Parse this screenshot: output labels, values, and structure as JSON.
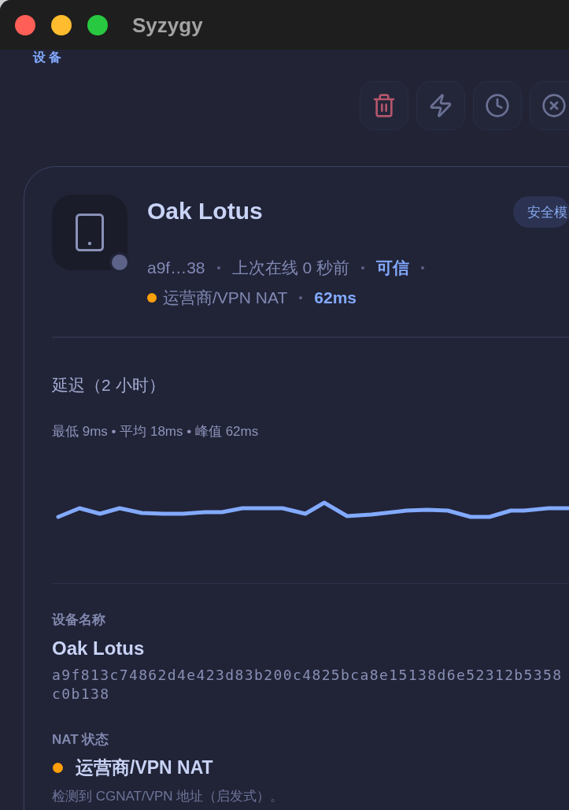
{
  "window": {
    "title": "Syzygy"
  },
  "breadcrumb": {
    "label": "设备"
  },
  "device": {
    "name": "Oak Lotus",
    "online": false,
    "badge": "安全模",
    "meta": [
      {
        "text": "a9f…38",
        "highlight": false
      },
      {
        "text": "上次在线 0 秒前",
        "highlight": false
      },
      {
        "text": "可信",
        "highlight": true
      }
    ],
    "nat": {
      "label": "运营商/VPN NAT",
      "color": "#ff9f0a"
    },
    "latency": "62ms"
  },
  "latency_panel": {
    "title": "延迟（2 小时）",
    "stats": "最低 9ms • 平均 18ms • 峰值 62ms"
  },
  "details": [
    {
      "kind": "name",
      "label": "设备名称",
      "value": "Oak Lotus",
      "hash_lines": [
        "a9f813c74862d4e423d83b200c4825bca8e15138d6e52312b5358",
        "c0b138"
      ]
    },
    {
      "kind": "status",
      "label": "NAT 状态",
      "value": "运营商/VPN NAT",
      "color": "#ff9f0a",
      "note": "检测到 CGNAT/VPN 地址（启发式）。"
    }
  ]
}
